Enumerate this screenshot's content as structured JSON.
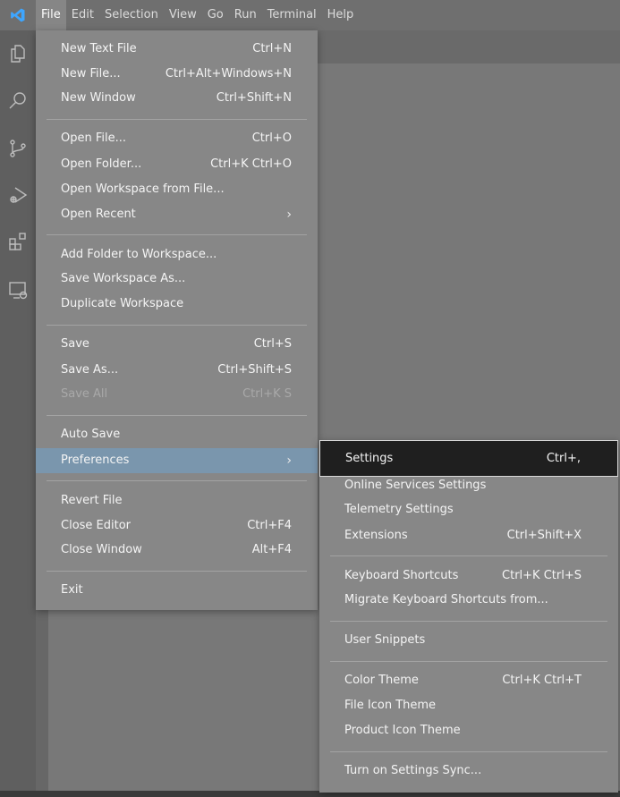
{
  "menubar": {
    "items": [
      "File",
      "Edit",
      "Selection",
      "View",
      "Go",
      "Run",
      "Terminal",
      "Help"
    ]
  },
  "activity_icons": [
    "explorer-icon",
    "search-icon",
    "source-control-icon",
    "run-debug-icon",
    "extensions-icon",
    "remote-explorer-icon"
  ],
  "file_menu": {
    "new_text_file": {
      "label": "New Text File",
      "shortcut": "Ctrl+N"
    },
    "new_file": {
      "label": "New File...",
      "shortcut": "Ctrl+Alt+Windows+N"
    },
    "new_window": {
      "label": "New Window",
      "shortcut": "Ctrl+Shift+N"
    },
    "open_file": {
      "label": "Open File...",
      "shortcut": "Ctrl+O"
    },
    "open_folder": {
      "label": "Open Folder...",
      "shortcut": "Ctrl+K Ctrl+O"
    },
    "open_workspace": {
      "label": "Open Workspace from File..."
    },
    "open_recent": {
      "label": "Open Recent"
    },
    "add_folder": {
      "label": "Add Folder to Workspace..."
    },
    "save_workspace_as": {
      "label": "Save Workspace As..."
    },
    "duplicate_workspace": {
      "label": "Duplicate Workspace"
    },
    "save": {
      "label": "Save",
      "shortcut": "Ctrl+S"
    },
    "save_as": {
      "label": "Save As...",
      "shortcut": "Ctrl+Shift+S"
    },
    "save_all": {
      "label": "Save All",
      "shortcut": "Ctrl+K S"
    },
    "auto_save": {
      "label": "Auto Save"
    },
    "preferences": {
      "label": "Preferences"
    },
    "revert_file": {
      "label": "Revert File"
    },
    "close_editor": {
      "label": "Close Editor",
      "shortcut": "Ctrl+F4"
    },
    "close_window": {
      "label": "Close Window",
      "shortcut": "Alt+F4"
    },
    "exit": {
      "label": "Exit"
    }
  },
  "preferences_menu": {
    "settings": {
      "label": "Settings",
      "shortcut": "Ctrl+,"
    },
    "online_services": {
      "label": "Online Services Settings"
    },
    "telemetry": {
      "label": "Telemetry Settings"
    },
    "extensions": {
      "label": "Extensions",
      "shortcut": "Ctrl+Shift+X"
    },
    "keyboard_shortcuts": {
      "label": "Keyboard Shortcuts",
      "shortcut": "Ctrl+K Ctrl+S"
    },
    "migrate_shortcuts": {
      "label": "Migrate Keyboard Shortcuts from..."
    },
    "user_snippets": {
      "label": "User Snippets"
    },
    "color_theme": {
      "label": "Color Theme",
      "shortcut": "Ctrl+K Ctrl+T"
    },
    "file_icon_theme": {
      "label": "File Icon Theme"
    },
    "product_icon_theme": {
      "label": "Product Icon Theme"
    },
    "settings_sync": {
      "label": "Turn on Settings Sync..."
    }
  },
  "colors": {
    "highlight": "#7a96ad",
    "selected": "#1f1f1f",
    "logo": "#3ea6ff"
  }
}
